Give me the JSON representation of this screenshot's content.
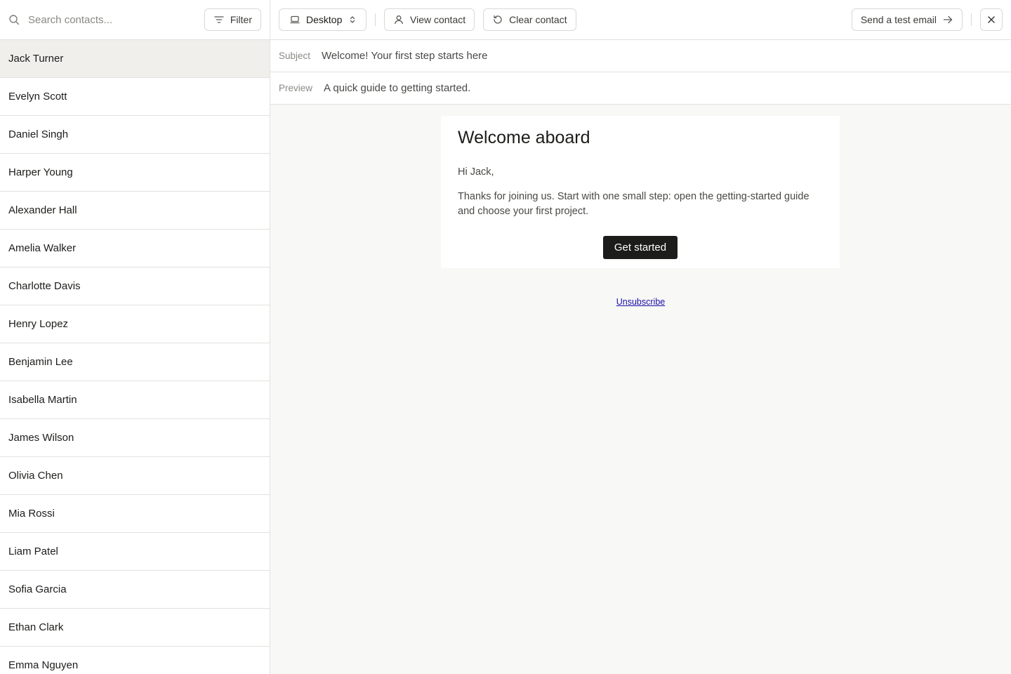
{
  "sidebar": {
    "search_placeholder": "Search contacts...",
    "filter_label": "Filter",
    "selected_index": 0,
    "contacts": [
      "Jack Turner",
      "Evelyn Scott",
      "Daniel Singh",
      "Harper Young",
      "Alexander Hall",
      "Amelia Walker",
      "Charlotte Davis",
      "Henry Lopez",
      "Benjamin Lee",
      "Isabella Martin",
      "James Wilson",
      "Olivia Chen",
      "Mia Rossi",
      "Liam Patel",
      "Sofia Garcia",
      "Ethan Clark",
      "Emma Nguyen"
    ]
  },
  "toolbar": {
    "device_label": "Desktop",
    "view_contact_label": "View contact",
    "clear_contact_label": "Clear contact",
    "send_test_label": "Send a test email",
    "icons": {
      "device": "laptop-icon",
      "device_select": "chevron-up-down-icon",
      "view_contact": "user-icon",
      "clear_contact": "reset-icon",
      "send_test": "arrow-right-icon",
      "close": "close-icon"
    }
  },
  "email_meta": {
    "subject_label": "Subject",
    "subject_value": "Welcome! Your first step starts here",
    "preview_label": "Preview",
    "preview_value": "A quick guide to getting started."
  },
  "email": {
    "title": "Welcome aboard",
    "greeting": "Hi Jack,",
    "body": "Thanks for joining us. Start with one small step: open the getting-started guide and choose your first project.",
    "cta_label": "Get started",
    "unsubscribe_label": "Unsubscribe"
  },
  "colors": {
    "cta_background": "#1c1c1a",
    "selected_row": "#f0efec",
    "preview_background": "#f8f8f6",
    "link": "#1a0dab"
  }
}
